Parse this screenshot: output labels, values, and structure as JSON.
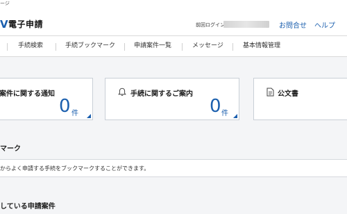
{
  "header": {
    "breadcrumb_fragment": "ージ",
    "logo_fragment": "V",
    "app_title": "電子申請",
    "last_login_label": "前回ログイン",
    "contact_link": "お問合せ",
    "help_link": "ヘルプ"
  },
  "nav": {
    "items": [
      {
        "label": "手続検索"
      },
      {
        "label": "手続ブックマーク"
      },
      {
        "label": "申請案件一覧"
      },
      {
        "label": "メッセージ"
      },
      {
        "label": "基本情報管理"
      }
    ]
  },
  "cards": [
    {
      "title": "案件に関する通知",
      "count": "0",
      "unit": "件",
      "icon": "none"
    },
    {
      "title": "手続に関するご案内",
      "count": "0",
      "unit": "件",
      "icon": "bell-icon"
    },
    {
      "title": "公文書",
      "count": "",
      "unit": "",
      "icon": "document-icon"
    }
  ],
  "bookmarks": {
    "title": "マーク",
    "description": "からよく申請する手続をブックマークすることができます。"
  },
  "applications": {
    "title": "している申請案件"
  },
  "colors": {
    "accent": "#1b5fae",
    "background": "#f4f5f7",
    "card_border": "#c9cfd6"
  }
}
